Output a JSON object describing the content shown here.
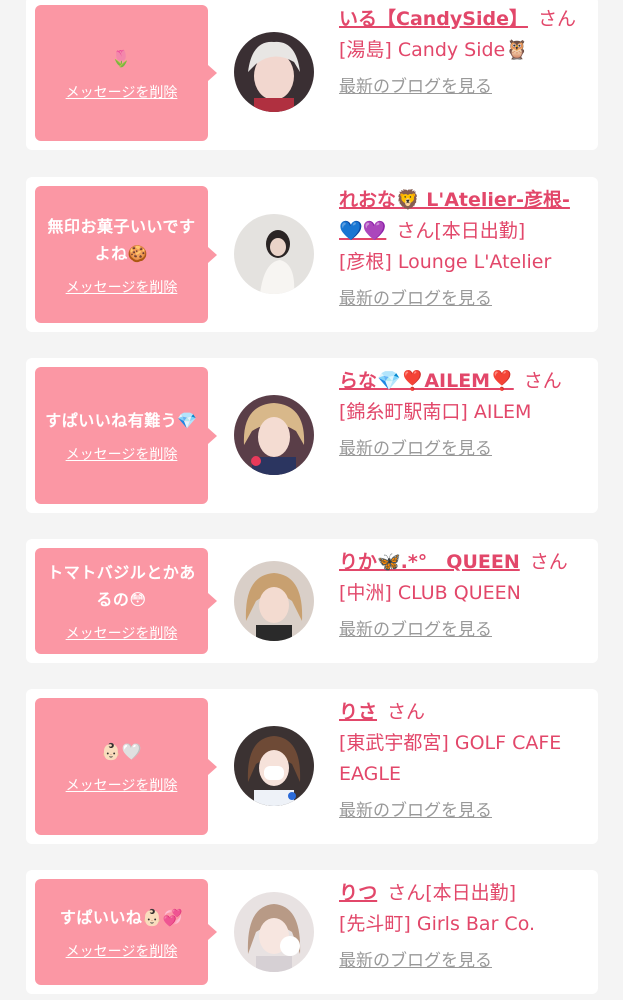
{
  "delete_label": "メッセージを削除",
  "blog_label": "最新のブログを見る",
  "cards": [
    {
      "message": "🌷",
      "name": "いる【CandySide】",
      "suffix": "さん",
      "store": "[湯島] Candy Side🦉"
    },
    {
      "message": "無印お菓子いいですよね🍪",
      "name": "れおな🦁 L'Atelier-彦根-💙💜",
      "suffix": "さん[本日出勤]",
      "store": "[彦根] Lounge L'Atelier"
    },
    {
      "message": "すぱいいね有難う💎",
      "name": "らな💎❣️AILEM❣️",
      "suffix": "さん",
      "store": "[錦糸町駅南口] AILEM"
    },
    {
      "message": "トマトバジルとかあるの😳",
      "name": "りか🦋.*°　QUEEN",
      "suffix": "さん",
      "store": "[中洲] CLUB QUEEN"
    },
    {
      "message": "👶🏻🤍",
      "name": "りさ",
      "suffix": "さん",
      "store": "[東武宇都宮] GOLF CAFE EAGLE"
    },
    {
      "message": "すぱいいね👶🏻💞",
      "name": "りつ",
      "suffix": "さん[本日出勤]",
      "store": "[先斗町] Girls Bar Co."
    }
  ],
  "colors": {
    "accent": "#e2476a",
    "bubble": "#fb97a4",
    "link_gray": "#999999",
    "background": "#f4f4f4"
  }
}
